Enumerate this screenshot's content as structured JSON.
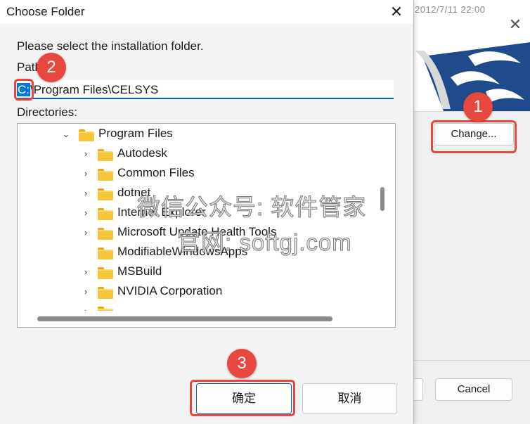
{
  "background_window": {
    "timestamp": "2012/7/11 22:00",
    "close_glyph": "✕",
    "change_button": "Change...",
    "cancel_button": "Cancel"
  },
  "dialog": {
    "title": "Choose Folder",
    "close_glyph": "✕",
    "instruction": "Please select the installation folder.",
    "path_label": "Path:",
    "path_value_selected": "C:",
    "path_value_rest": "\\Program Files\\CELSYS",
    "directories_label": "Directories:",
    "tree": [
      {
        "label": "Program Files",
        "expanded": true
      },
      {
        "label": "Autodesk"
      },
      {
        "label": "Common Files"
      },
      {
        "label": "dotnet"
      },
      {
        "label": "Internet Explorer"
      },
      {
        "label": "Microsoft Update Health Tools"
      },
      {
        "label": "ModifiableWindowsApps"
      },
      {
        "label": "MSBuild"
      },
      {
        "label": "NVIDIA Corporation"
      }
    ],
    "ok_button": "确定",
    "cancel_button": "取消"
  },
  "watermark": {
    "line1": "微信公众号: 软件管家",
    "line2": "官网: softgj.com"
  },
  "annotations": {
    "step1": "1",
    "step2": "2",
    "step3": "3",
    "color": "#e8473d"
  },
  "icons": {
    "chevron_right": "›",
    "chevron_down": "⌄"
  }
}
